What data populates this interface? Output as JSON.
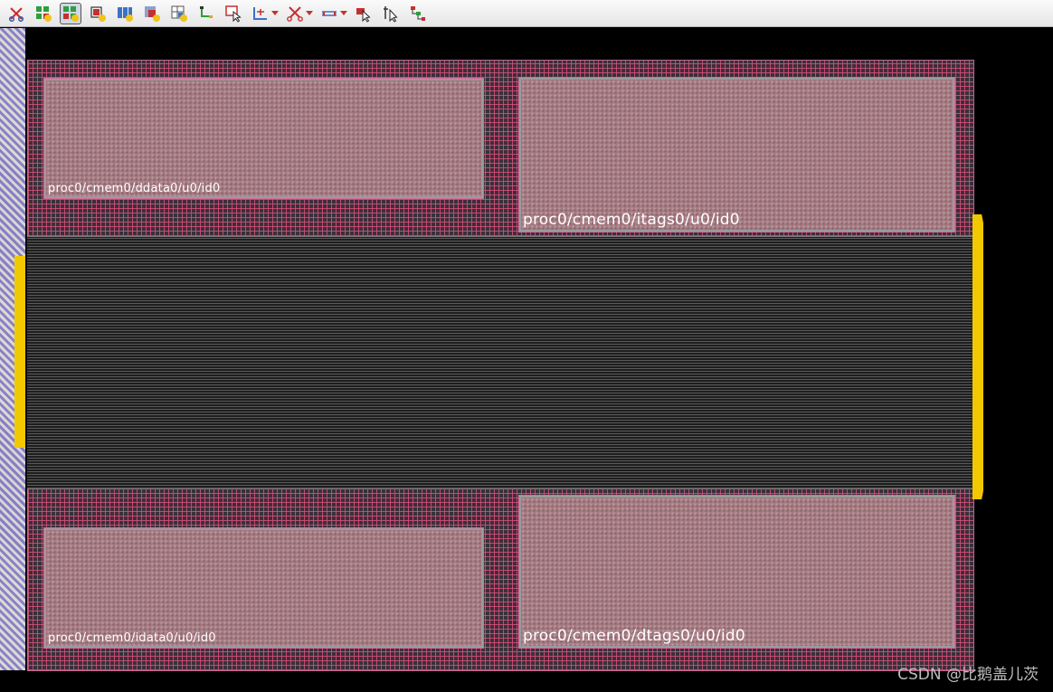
{
  "toolbar": {
    "items": [
      {
        "icon": "cut-icon",
        "has_dropdown": false,
        "active": false
      },
      {
        "icon": "add-cell-green-icon",
        "has_dropdown": false,
        "active": false
      },
      {
        "icon": "add-cell-orange-icon",
        "has_dropdown": false,
        "active": true
      },
      {
        "icon": "add-instance-icon",
        "has_dropdown": false,
        "active": false
      },
      {
        "icon": "add-bus-icon",
        "has_dropdown": false,
        "active": false
      },
      {
        "icon": "add-cell-red-icon",
        "has_dropdown": false,
        "active": false
      },
      {
        "icon": "add-grid-icon",
        "has_dropdown": false,
        "active": false
      },
      {
        "icon": "route-icon",
        "has_dropdown": false,
        "active": false
      },
      {
        "icon": "select-box-icon",
        "has_dropdown": false,
        "active": false
      },
      {
        "icon": "ruler-icon",
        "has_dropdown": true,
        "active": false
      },
      {
        "icon": "scissors-icon",
        "has_dropdown": true,
        "active": false
      },
      {
        "icon": "stretch-icon",
        "has_dropdown": true,
        "active": false
      },
      {
        "icon": "move-pointer-icon",
        "has_dropdown": false,
        "active": false
      },
      {
        "icon": "align-pointer-icon",
        "has_dropdown": false,
        "active": false
      },
      {
        "icon": "net-tree-icon",
        "has_dropdown": false,
        "active": false
      }
    ]
  },
  "layout": {
    "macros": [
      {
        "id": "ddata",
        "label": "proc0/cmem0/ddata0/u0/id0"
      },
      {
        "id": "itags",
        "label": "proc0/cmem0/itags0/u0/id0"
      },
      {
        "id": "idata",
        "label": "proc0/cmem0/idata0/u0/id0"
      },
      {
        "id": "dtags",
        "label": "proc0/cmem0/dtags0/u0/id0"
      }
    ]
  },
  "colors": {
    "macro_fill": "#a67b82",
    "routing_grid": "#d65078",
    "io_pins": "#f2c800",
    "core_rows": "#5a5a5a"
  },
  "watermark": "CSDN @比鹅盖儿茨"
}
